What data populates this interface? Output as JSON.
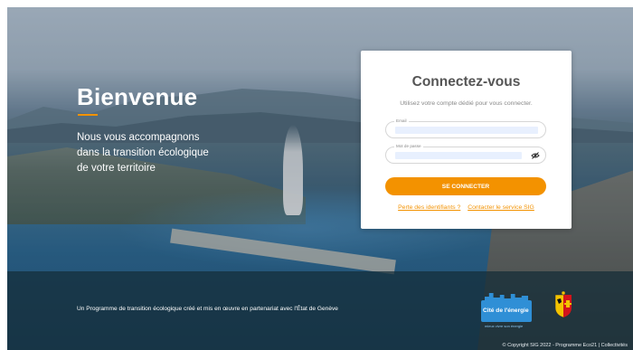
{
  "hero": {
    "title": "Bienvenue",
    "subtitle_lines": [
      "Nous vous accompagnons",
      "dans la transition écologique",
      "de votre territoire"
    ]
  },
  "login": {
    "title": "Connectez-vous",
    "subtitle": "Utilisez votre compte dédié pour vous connecter.",
    "email": {
      "label": "Email",
      "value": ""
    },
    "password": {
      "label": "Mot de passe",
      "value": ""
    },
    "submit_label": "SE CONNECTER",
    "link_lost": "Perte des identifiants ?",
    "link_contact": "Contacter le service SIG"
  },
  "footer": {
    "program_text": "Un Programme de transition écologique créé et mis en œuvre en partenariat avec l'État de Genève",
    "logo_cite_label": "Cité de l'énergie",
    "logo_cite_small": "mieux vivre son énergie",
    "copyright": "© Copyright SIG 2022 - Programme Eco21 | Collectivités"
  },
  "colors": {
    "accent": "#f39200",
    "card": "#ffffff",
    "title": "#555555"
  },
  "icons": {
    "password_toggle": "eye-slash-icon",
    "crest": "geneva-crest-icon"
  }
}
